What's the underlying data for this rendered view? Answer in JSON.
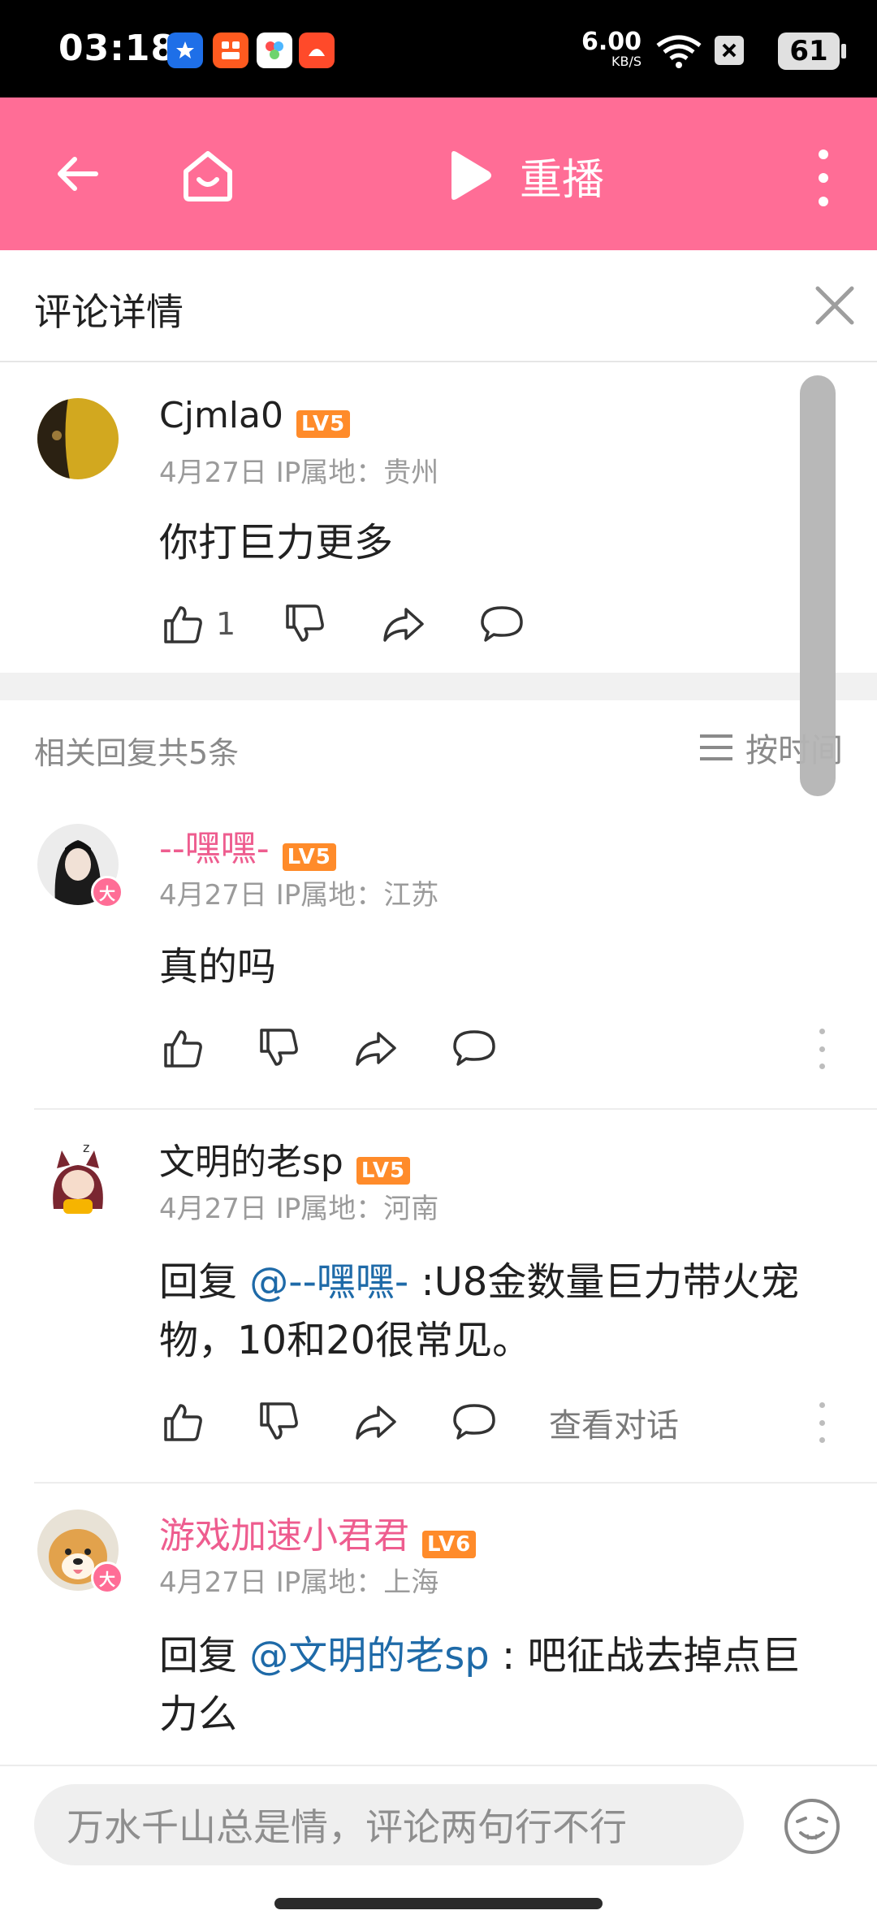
{
  "status_bar": {
    "time": "03:18",
    "net_speed": "6.00",
    "net_unit": "KB/S",
    "battery": "61"
  },
  "top_bar": {
    "replay_label": "重播"
  },
  "comment_header": {
    "title": "评论详情"
  },
  "main_comment": {
    "username": "Cjmla0",
    "level": "LV5",
    "date": "4月27日",
    "ip": "IP属地：贵州",
    "text": "你打巨力更多",
    "likes": "1"
  },
  "replies_header": {
    "label": "相关回复共5条",
    "sort": "按时间"
  },
  "replies": [
    {
      "username": "--嘿嘿-",
      "level": "LV5",
      "date": "4月27日",
      "ip": "IP属地：江苏",
      "text": "真的吗"
    },
    {
      "username": "文明的老sp",
      "level": "LV5",
      "date": "4月27日",
      "ip": "IP属地：河南",
      "reply_prefix": "回复 ",
      "mention": "@--嘿嘿-",
      "text_line1": " :U8金数量巨力带火宠",
      "text_line2": "物，10和20很常见。",
      "view_conversation": "查看对话"
    },
    {
      "username": "游戏加速小君君",
      "level": "LV6",
      "date": "4月27日",
      "ip": "IP属地：上海",
      "reply_prefix": "回复 ",
      "mention": "@文明的老sp",
      "text_line1": " : 吧征战去掉点巨",
      "text_line2": "力么"
    }
  ],
  "bottom_bar": {
    "input_placeholder": "万水千山总是情，评论两句行不行"
  },
  "badge_text": "大"
}
